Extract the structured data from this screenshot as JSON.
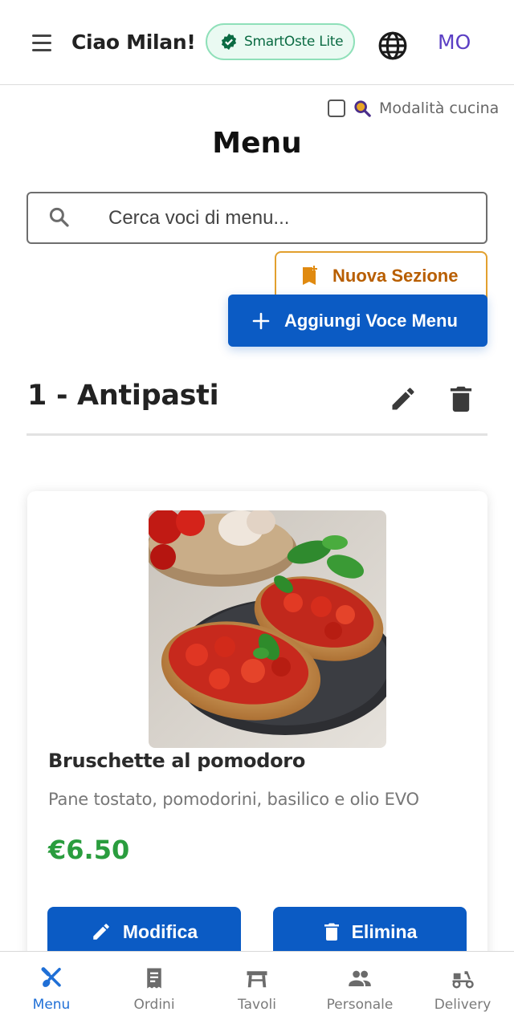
{
  "header": {
    "greeting": "Ciao Milan!",
    "plan_badge": "SmartOste Lite",
    "avatar_initials": "MO",
    "icons": [
      "hamburger-menu-icon",
      "verified-badge-icon",
      "globe-icon"
    ]
  },
  "kitchen_mode": {
    "label": "Modalità cucina",
    "checked": false
  },
  "page": {
    "title": "Menu"
  },
  "search": {
    "placeholder": "Cerca voci di menu...",
    "value": ""
  },
  "actions": {
    "new_section": "Nuova Sezione",
    "add_item": "Aggiungi Voce Menu"
  },
  "section": {
    "title": "1 - Antipasti",
    "items": [
      {
        "name": "Bruschette al pomodoro",
        "description": "Pane tostato, pomodorini, basilico e olio EVO",
        "price": "€6.50",
        "edit_label": "Modifica",
        "delete_label": "Elimina"
      }
    ]
  },
  "bottom_nav": {
    "items": [
      {
        "label": "Menu",
        "icon": "cutlery-icon",
        "active": true
      },
      {
        "label": "Ordini",
        "icon": "receipt-icon",
        "active": false
      },
      {
        "label": "Tavoli",
        "icon": "table-icon",
        "active": false
      },
      {
        "label": "Personale",
        "icon": "people-icon",
        "active": false
      },
      {
        "label": "Delivery",
        "icon": "scooter-icon",
        "active": false
      }
    ]
  },
  "colors": {
    "primary_blue": "#0b5bc4",
    "accent_orange": "#b85e00",
    "price_green": "#2a9d3e",
    "badge_green": "#0b6b43",
    "avatar_purple": "#5b3fc4",
    "nav_active": "#1f6fd6"
  }
}
